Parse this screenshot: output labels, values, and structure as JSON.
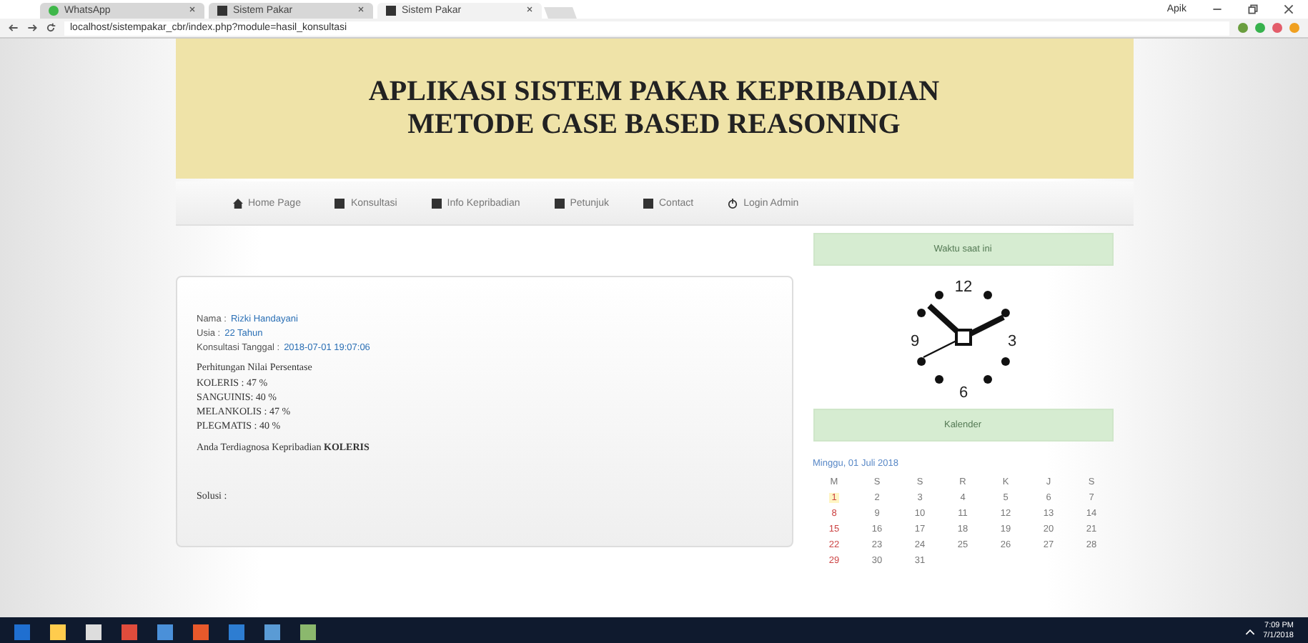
{
  "browser": {
    "tabs": [
      {
        "title": "WhatsApp",
        "selected": false
      },
      {
        "title": "Sistem Pakar",
        "selected": false
      },
      {
        "title": "Sistem Pakar",
        "selected": true
      }
    ],
    "url": "localhost/sistempakar_cbr/index.php?module=hasil_konsultasi",
    "window_user": "Apik"
  },
  "header": {
    "title_lines": [
      "APLIKASI SISTEM PAKAR KEPRIBADIAN",
      "METODE CASE BASED REASONING"
    ]
  },
  "nav": [
    {
      "label": "Home Page",
      "kind": "home"
    },
    {
      "label": "Konsultasi",
      "kind": "box"
    },
    {
      "label": "Info Kepribadian",
      "kind": "box"
    },
    {
      "label": "Petunjuk",
      "kind": "box"
    },
    {
      "label": "Contact",
      "kind": "box"
    },
    {
      "label": "Login Admin",
      "kind": "power"
    }
  ],
  "result": {
    "fields": [
      {
        "label": "Nama :",
        "value": "Rizki Handayani"
      },
      {
        "label": "Usia :",
        "value": "22 Tahun"
      },
      {
        "label": "Konsultasi Tanggal :",
        "value": "2018-07-01 19:07:06"
      }
    ],
    "heading": "Perhitungan Nilai Persentase",
    "scores": [
      "KOLERIS : 47 %",
      "SANGUINIS: 40 %",
      "MELANKOLIS : 47 %",
      "PLEGMATIS : 40 %"
    ],
    "diagnosis": "Anda Terdiagnosa Kepribadian **KOLERIS**",
    "solution": "Solusi :"
  },
  "sidebar": {
    "clock_title": "Waktu saat ini",
    "clock_numbers": [
      "12",
      "3",
      "6",
      "9"
    ],
    "calendar_title": "Kalender",
    "calendar": {
      "caption": "Minggu, 01 Juli 2018",
      "weekdays": [
        "M",
        "S",
        "S",
        "R",
        "K",
        "J",
        "S"
      ],
      "weeks": [
        [
          {
            "day": "1",
            "selected": true
          },
          {
            "day": "2",
            "selected": false
          },
          {
            "day": "3",
            "selected": false
          },
          {
            "day": "4",
            "selected": false
          },
          {
            "day": "5",
            "selected": false
          },
          {
            "day": "6",
            "selected": false
          },
          {
            "day": "7",
            "selected": false
          }
        ],
        [
          {
            "day": "8",
            "selected": false
          },
          {
            "day": "9",
            "selected": false
          },
          {
            "day": "10",
            "selected": false
          },
          {
            "day": "11",
            "selected": false
          },
          {
            "day": "12",
            "selected": false
          },
          {
            "day": "13",
            "selected": false
          },
          {
            "day": "14",
            "selected": false
          }
        ],
        [
          {
            "day": "15",
            "selected": false
          },
          {
            "day": "16",
            "selected": false
          },
          {
            "day": "17",
            "selected": false
          },
          {
            "day": "18",
            "selected": false
          },
          {
            "day": "19",
            "selected": false
          },
          {
            "day": "20",
            "selected": false
          },
          {
            "day": "21",
            "selected": false
          }
        ],
        [
          {
            "day": "22",
            "selected": false
          },
          {
            "day": "23",
            "selected": false
          },
          {
            "day": "24",
            "selected": false
          },
          {
            "day": "25",
            "selected": false
          },
          {
            "day": "26",
            "selected": false
          },
          {
            "day": "27",
            "selected": false
          },
          {
            "day": "28",
            "selected": false
          }
        ],
        [
          {
            "day": "29",
            "selected": false
          },
          {
            "day": "30",
            "selected": false
          },
          {
            "day": "31",
            "selected": false
          }
        ]
      ]
    }
  },
  "taskbar": {
    "time": "7:09 PM",
    "date": "7/1/2018"
  }
}
